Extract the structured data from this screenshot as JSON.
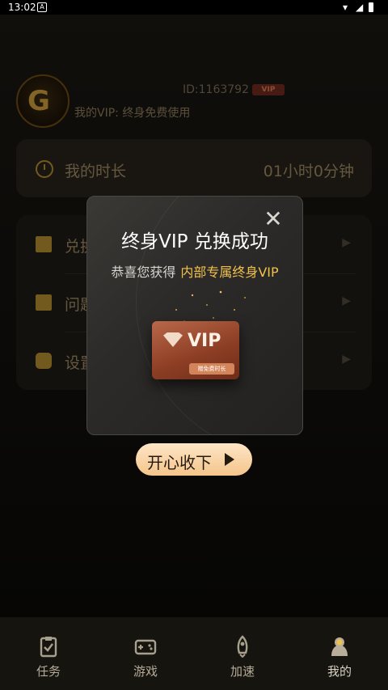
{
  "status_bar": {
    "time": "13:02",
    "notification": "A"
  },
  "profile": {
    "user_id": "ID:1163792",
    "vip_badge": "VIP",
    "vip_status": "我的VIP: 终身免费使用"
  },
  "time_card": {
    "label": "我的时长",
    "value": "01小时0分钟"
  },
  "menu": {
    "items": [
      {
        "label": "兑换"
      },
      {
        "label": "问题"
      },
      {
        "label": "设置"
      }
    ]
  },
  "modal": {
    "title": "终身VIP 兑换成功",
    "subtitle_prefix": "恭喜您获得",
    "subtitle_highlight": "内部专属终身VIP",
    "card_label": "VIP",
    "card_strip": "赠免费时长"
  },
  "accept_button": {
    "label": "开心收下"
  },
  "bottom_nav": {
    "tabs": [
      {
        "label": "任务"
      },
      {
        "label": "游戏"
      },
      {
        "label": "加速"
      },
      {
        "label": "我的"
      }
    ]
  },
  "colors": {
    "accent_gold": "#f2c04c",
    "card_brown": "#8e3f25",
    "button_peach": "#f5c58a"
  }
}
